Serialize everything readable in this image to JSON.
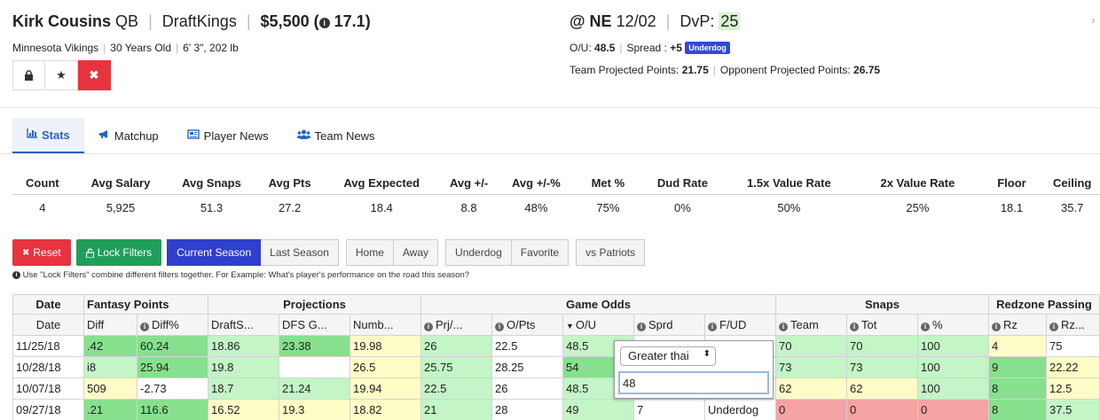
{
  "player": {
    "name": "Kirk Cousins",
    "position": "QB",
    "site": "DraftKings",
    "salary": "$5,500",
    "projection": "17.1",
    "team": "Minnesota Vikings",
    "age": "30 Years Old",
    "size": "6' 3\", 202 lb"
  },
  "matchup": {
    "opponent": "@ NE",
    "date": "12/02",
    "dvp_label": "DvP:",
    "dvp_value": "25",
    "ou_label": "O/U:",
    "ou_value": "48.5",
    "spread_label": "Spread :",
    "spread_value": "+5",
    "spread_badge": "Underdog",
    "team_proj_label": "Team Projected Points:",
    "team_proj_value": "21.75",
    "opp_proj_label": "Opponent Projected Points:",
    "opp_proj_value": "26.75"
  },
  "tabs": [
    {
      "label": "Stats",
      "icon": "bar-chart-icon"
    },
    {
      "label": "Matchup",
      "icon": "megaphone-icon"
    },
    {
      "label": "Player News",
      "icon": "newspaper-icon"
    },
    {
      "label": "Team News",
      "icon": "users-icon"
    }
  ],
  "summary": {
    "headers": [
      "Count",
      "Avg Salary",
      "Avg Snaps",
      "Avg Pts",
      "Avg Expected",
      "Avg +/-",
      "Avg +/-%",
      "Met %",
      "Dud Rate",
      "1.5x Value Rate",
      "2x Value Rate",
      "Floor",
      "Ceiling"
    ],
    "values": [
      "4",
      "5,925",
      "51.3",
      "27.2",
      "18.4",
      "8.8",
      "48%",
      "75%",
      "0%",
      "50%",
      "25%",
      "18.1",
      "35.7"
    ]
  },
  "filters": {
    "reset": "Reset",
    "lock": "Lock Filters",
    "current_season": "Current Season",
    "last_season": "Last Season",
    "home": "Home",
    "away": "Away",
    "underdog": "Underdog",
    "favorite": "Favorite",
    "vs_team": "vs Patriots",
    "hint": "Use \"Lock Filters\" combine different filters together. For Example: What's player's performance on the road this season?"
  },
  "grid": {
    "groups": [
      "Date",
      "Fantasy Points",
      "Projections",
      "Game Odds",
      "Snaps",
      "Redzone Passing"
    ],
    "columns": [
      "Date",
      "Diff",
      "Diff%",
      "DraftS...",
      "DFS G...",
      "Numb...",
      "Prj/...",
      "O/Pts",
      "O/U",
      "Sprd",
      "F/UD",
      "Team",
      "Tot",
      "%",
      "Rz",
      "Rz..."
    ],
    "rows": [
      [
        "11/25/18",
        ".42",
        "60.24",
        "18.86",
        "23.38",
        "19.98",
        "26",
        "22.5",
        "48.5",
        "",
        "",
        "70",
        "70",
        "100",
        "4",
        "75"
      ],
      [
        "10/28/18",
        "i8",
        "25.94",
        "19.8",
        "",
        "26.5",
        "25.75",
        "28.25",
        "54",
        "",
        "",
        "73",
        "73",
        "100",
        "9",
        "22.22"
      ],
      [
        "10/07/18",
        "509",
        "-2.73",
        "18.7",
        "21.24",
        "19.94",
        "22.5",
        "26",
        "48.5",
        "",
        "",
        "62",
        "62",
        "100",
        "8",
        "12.5"
      ],
      [
        "09/27/18",
        ".21",
        "116.6",
        "16.52",
        "19.3",
        "18.82",
        "21",
        "28",
        "49",
        "7",
        "Underdog",
        "0",
        "0",
        "0",
        "8",
        "37.5"
      ]
    ]
  },
  "ou_filter": {
    "operator": "Greater thai",
    "value": "48"
  }
}
